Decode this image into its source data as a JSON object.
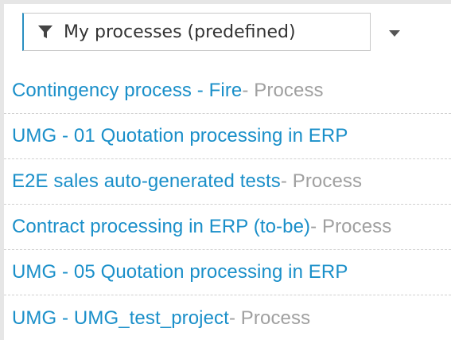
{
  "filter": {
    "icon": "filter-icon",
    "label": "My processes (predefined)",
    "dropdown_icon": "chevron-down-icon"
  },
  "colors": {
    "link": "#1a8fc9",
    "type_text": "#a0a0a0",
    "focus_border": "#2a8fc1"
  },
  "items": [
    {
      "name": "Contingency process - Fire",
      "type": " - Process"
    },
    {
      "name": "UMG - 01 Quotation processing in ERP",
      "type": ""
    },
    {
      "name": "E2E sales auto-generated tests",
      "type": " - Process"
    },
    {
      "name": "Contract processing in ERP (to-be)",
      "type": " - Process"
    },
    {
      "name": "UMG - 05 Quotation processing in ERP",
      "type": ""
    },
    {
      "name": "UMG - UMG_test_project",
      "type": " - Process"
    }
  ]
}
